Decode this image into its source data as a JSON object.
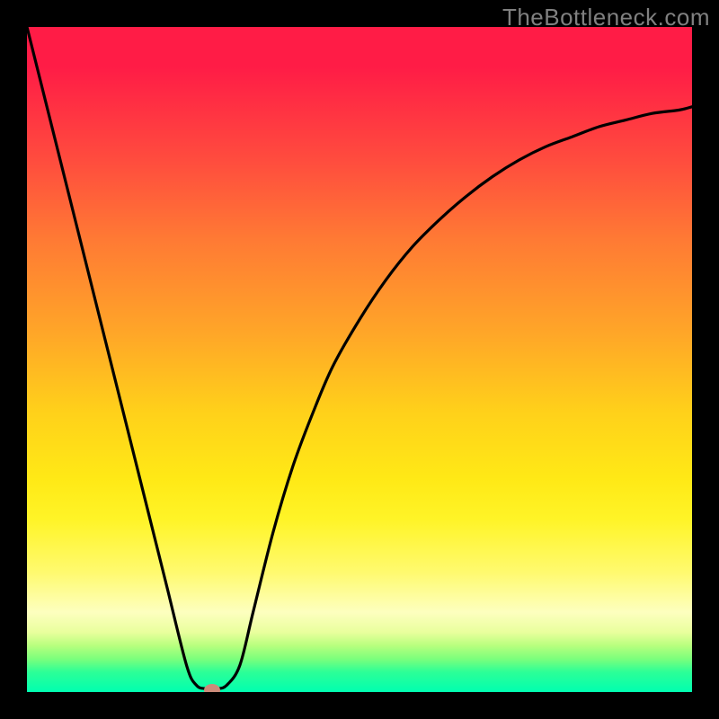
{
  "watermark": "TheBottleneck.com",
  "chart_data": {
    "type": "line",
    "title": "",
    "xlabel": "",
    "ylabel": "",
    "xlim": [
      0,
      1
    ],
    "ylim": [
      0,
      1
    ],
    "series": [
      {
        "name": "bottleneck-curve",
        "x": [
          0.0,
          0.03,
          0.06,
          0.09,
          0.12,
          0.15,
          0.18,
          0.21,
          0.24,
          0.255,
          0.27,
          0.285,
          0.3,
          0.32,
          0.34,
          0.37,
          0.4,
          0.43,
          0.46,
          0.5,
          0.54,
          0.58,
          0.62,
          0.66,
          0.7,
          0.74,
          0.78,
          0.82,
          0.86,
          0.9,
          0.94,
          0.98,
          1.0
        ],
        "y": [
          1.0,
          0.88,
          0.76,
          0.64,
          0.52,
          0.4,
          0.28,
          0.16,
          0.04,
          0.01,
          0.005,
          0.005,
          0.01,
          0.04,
          0.12,
          0.24,
          0.34,
          0.42,
          0.49,
          0.56,
          0.62,
          0.67,
          0.71,
          0.745,
          0.775,
          0.8,
          0.82,
          0.835,
          0.85,
          0.86,
          0.87,
          0.875,
          0.88
        ]
      }
    ],
    "minimum_point": {
      "x": 0.278,
      "y": 0.003
    },
    "gradient_colors": {
      "top": "#ff1c46",
      "mid": "#ffd11a",
      "bottom": "#00ffb0"
    },
    "curve_color": "#000000",
    "dot_color": "#cc8b7a",
    "frame_color": "#000000"
  }
}
